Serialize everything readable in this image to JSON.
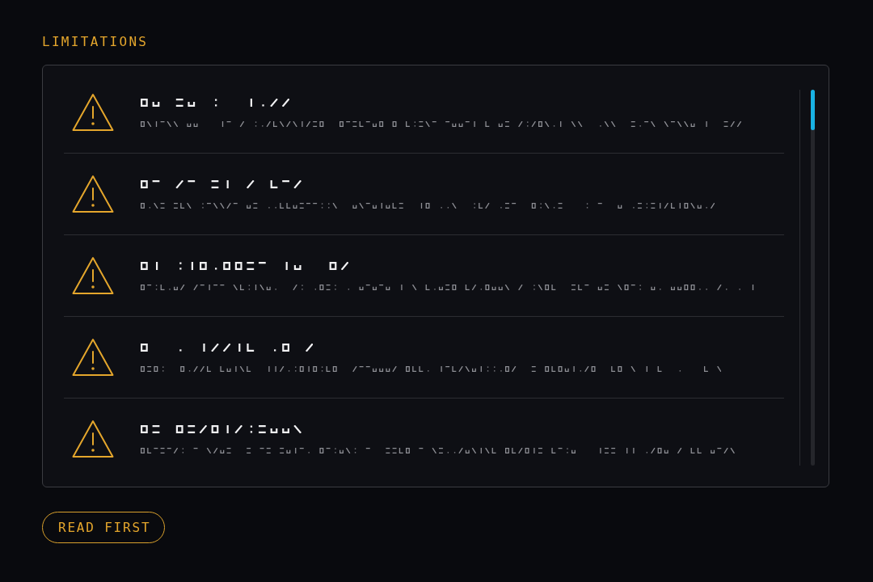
{
  "heading": "LIMITATIONS",
  "limitations": {
    "items": [
      {
        "kind": "warning"
      },
      {
        "kind": "warning"
      },
      {
        "kind": "warning"
      },
      {
        "kind": "warning"
      },
      {
        "kind": "warning"
      }
    ]
  },
  "button": {
    "label": "READ FIRST"
  }
}
